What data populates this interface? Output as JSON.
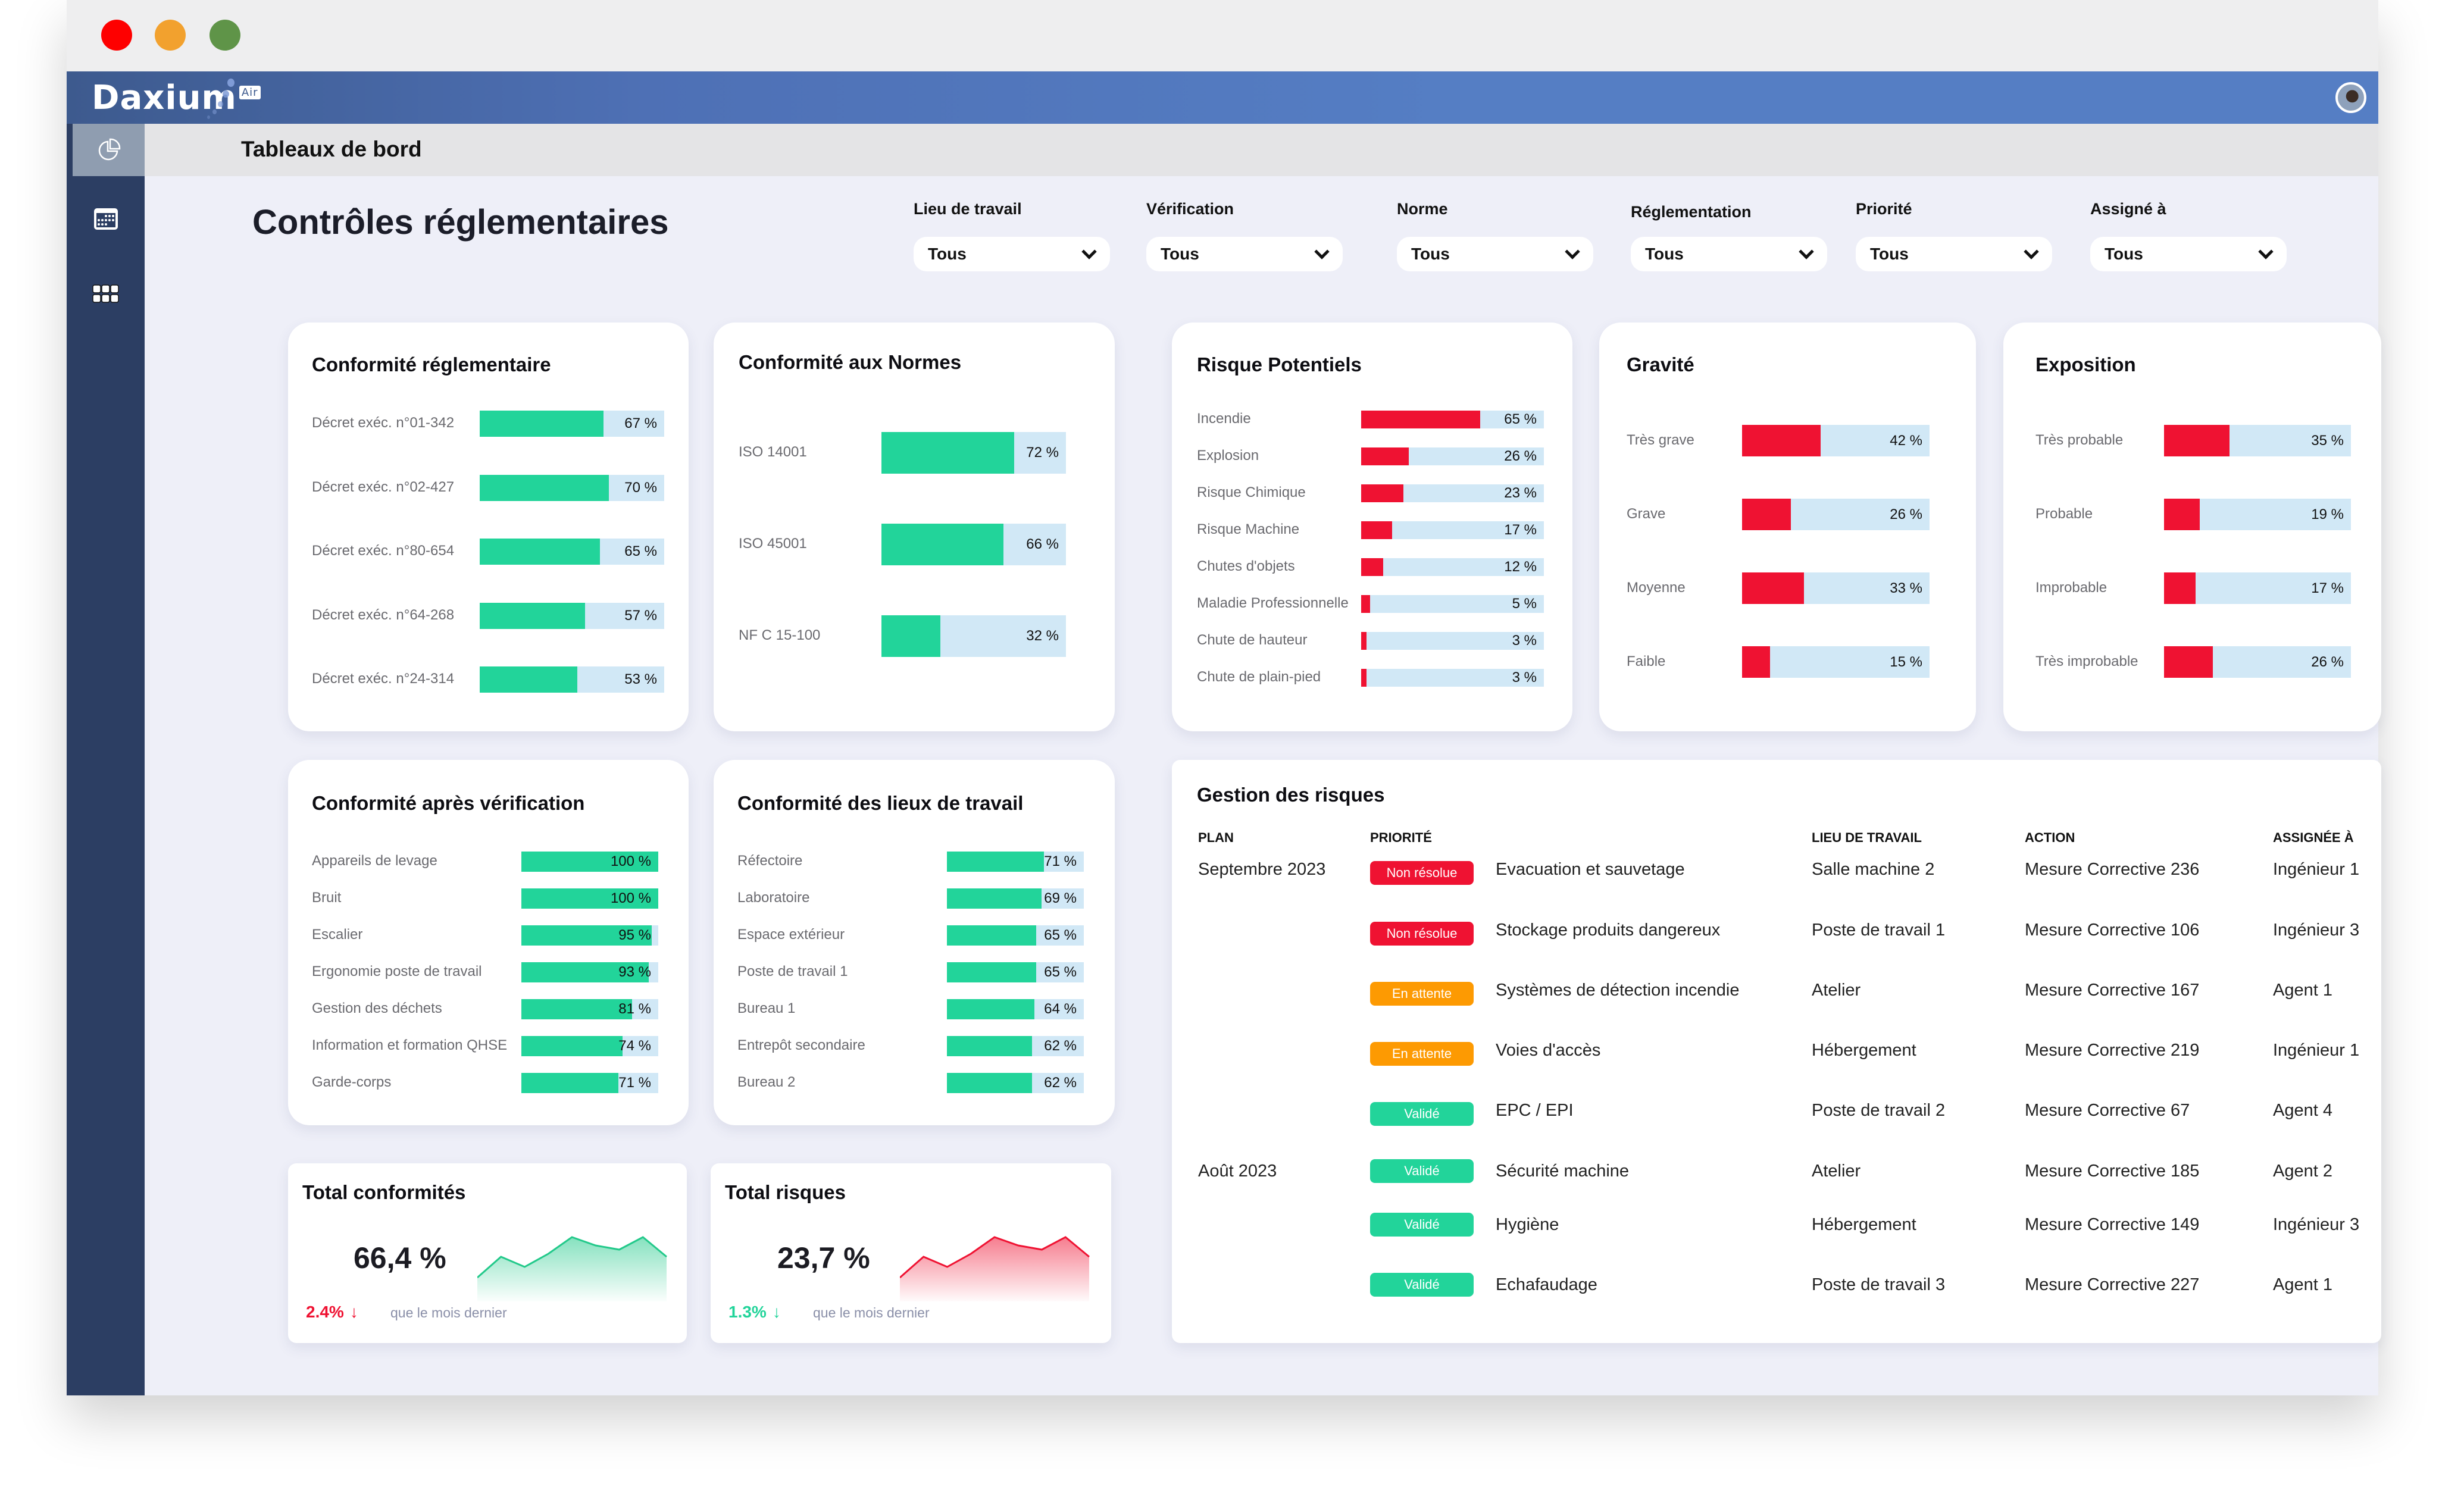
{
  "window": {
    "controls": [
      "close",
      "minimize",
      "maximize"
    ]
  },
  "header": {
    "logo": "Daxium",
    "logo_badge": "Air",
    "avatar_icon": "user-avatar"
  },
  "subheader": {
    "title": "Tableaux de bord"
  },
  "sidebar": {
    "items": [
      {
        "icon": "pie-chart-icon",
        "label": "Tableaux de bord",
        "active": true
      },
      {
        "icon": "calendar-icon",
        "label": "Calendrier"
      },
      {
        "icon": "apps-grid-icon",
        "label": "Applications"
      }
    ]
  },
  "page": {
    "title": "Contrôles réglementaires"
  },
  "filters": [
    {
      "label": "Lieu de travail",
      "value": "Tous"
    },
    {
      "label": "Vérification",
      "value": "Tous"
    },
    {
      "label": "Norme",
      "value": "Tous"
    },
    {
      "label": "Réglementation",
      "value": "Tous"
    },
    {
      "label": "Priorité",
      "value": "Tous"
    },
    {
      "label": "Assigné à",
      "value": "Tous"
    }
  ],
  "colors": {
    "green": "#22d49a",
    "red": "#ef1232",
    "track": "#d1e8f6",
    "orange": "#fd9a02"
  },
  "chart_data": [
    {
      "type": "bar",
      "title": "Conformité réglementaire",
      "orientation": "horizontal",
      "unit": "%",
      "xlim": [
        0,
        100
      ],
      "categories": [
        "Décret exéc. n°01-342",
        "Décret exéc. n°02-427",
        "Décret exéc. n°80-654",
        "Décret exéc. n°64-268",
        "Décret exéc. n°24-314"
      ],
      "values": [
        67,
        70,
        65,
        57,
        53
      ],
      "labels": [
        "67 %",
        "70 %",
        "65 %",
        "57 %",
        "53 %"
      ],
      "color": "#22d49a"
    },
    {
      "type": "bar",
      "title": "Conformité aux Normes",
      "orientation": "horizontal",
      "unit": "%",
      "xlim": [
        0,
        100
      ],
      "categories": [
        "ISO 14001",
        "ISO 45001",
        "NF C 15-100"
      ],
      "values": [
        72,
        66,
        32
      ],
      "labels": [
        "72 %",
        "66 %",
        "32 %"
      ],
      "color": "#22d49a"
    },
    {
      "type": "bar",
      "title": "Risque Potentiels",
      "orientation": "horizontal",
      "unit": "%",
      "xlim": [
        0,
        100
      ],
      "categories": [
        "Incendie",
        "Explosion",
        "Risque Chimique",
        "Risque Machine",
        "Chutes d'objets",
        "Maladie Professionnelle",
        "Chute de hauteur",
        "Chute de plain-pied"
      ],
      "values": [
        65,
        26,
        23,
        17,
        12,
        5,
        3,
        3
      ],
      "labels": [
        "65 %",
        "26 %",
        "23 %",
        "17 %",
        "12 %",
        "5 %",
        "3 %",
        "3 %"
      ],
      "color": "#ef1232"
    },
    {
      "type": "bar",
      "title": "Gravité",
      "orientation": "horizontal",
      "unit": "%",
      "xlim": [
        0,
        100
      ],
      "categories": [
        "Très grave",
        "Grave",
        "Moyenne",
        "Faible"
      ],
      "values": [
        42,
        26,
        33,
        15
      ],
      "labels": [
        "42 %",
        "26 %",
        "33 %",
        "15 %"
      ],
      "color": "#ef1232"
    },
    {
      "type": "bar",
      "title": "Exposition",
      "orientation": "horizontal",
      "unit": "%",
      "xlim": [
        0,
        100
      ],
      "categories": [
        "Très probable",
        "Probable",
        "Improbable",
        "Très improbable"
      ],
      "values": [
        35,
        19,
        17,
        26
      ],
      "labels": [
        "35 %",
        "19 %",
        "17 %",
        "26 %"
      ],
      "color": "#ef1232"
    },
    {
      "type": "bar",
      "title": "Conformité après vérification",
      "orientation": "horizontal",
      "unit": "%",
      "xlim": [
        0,
        100
      ],
      "categories": [
        "Appareils de levage",
        "Bruit",
        "Escalier",
        "Ergonomie poste de travail",
        "Gestion des déchets",
        "Information et formation QHSE",
        "Garde-corps"
      ],
      "values": [
        100,
        100,
        95,
        93,
        81,
        74,
        71
      ],
      "labels": [
        "100 %",
        "100 %",
        "95 %",
        "93 %",
        "81 %",
        "74 %",
        "71 %"
      ],
      "color": "#22d49a"
    },
    {
      "type": "bar",
      "title": "Conformité des lieux de travail",
      "orientation": "horizontal",
      "unit": "%",
      "xlim": [
        0,
        100
      ],
      "categories": [
        "Réfectoire",
        "Laboratoire",
        "Espace extérieur",
        "Poste de travail 1",
        "Bureau 1",
        "Entrepôt secondaire",
        "Bureau 2"
      ],
      "values": [
        71,
        69,
        65,
        65,
        64,
        62,
        62
      ],
      "labels": [
        "71 %",
        "69 %",
        "65 %",
        "65 %",
        "64 %",
        "62 %",
        "62 %"
      ],
      "color": "#22d49a"
    },
    {
      "type": "area",
      "title": "Total conformités",
      "values": [
        20,
        55,
        38,
        60,
        88,
        74,
        67,
        88,
        55
      ],
      "color": "#22c98a"
    },
    {
      "type": "area",
      "title": "Total risques",
      "values": [
        20,
        55,
        38,
        60,
        88,
        74,
        67,
        88,
        55
      ],
      "color": "#ef1232"
    }
  ],
  "totals": [
    {
      "title": "Total conformités",
      "value": "66,4 %",
      "delta": "2.4%",
      "delta_arrow": "↓",
      "delta_color": "#ef1232",
      "note": "que le mois dernier"
    },
    {
      "title": "Total risques",
      "value": "23,7 %",
      "delta": "1.3%",
      "delta_arrow": "↓",
      "delta_color": "#22d49a",
      "note": "que le mois dernier"
    }
  ],
  "risk_table": {
    "title": "Gestion des risques",
    "columns": {
      "plan": "PLAN",
      "priority": "PRIORITÉ",
      "workplace": "LIEU DE TRAVAIL",
      "action": "ACTION",
      "assignee": "ASSIGNÉE À"
    },
    "rows": [
      {
        "plan": "Septembre 2023",
        "status": "Non résolue",
        "status_color": "#ef1232",
        "item": "Evacuation et sauvetage",
        "workplace": "Salle machine 2",
        "action": "Mesure Corrective  236",
        "assignee": "Ingénieur 1"
      },
      {
        "plan": "",
        "status": "Non résolue",
        "status_color": "#ef1232",
        "item": "Stockage produits dangereux",
        "workplace": "Poste de travail 1",
        "action": "Mesure Corrective  106",
        "assignee": "Ingénieur 3"
      },
      {
        "plan": "",
        "status": "En attente",
        "status_color": "#fd9a02",
        "item": "Systèmes de détection incendie",
        "workplace": "Atelier",
        "action": "Mesure Corrective 167",
        "assignee": "Agent 1"
      },
      {
        "plan": "",
        "status": "En attente",
        "status_color": "#fd9a02",
        "item": "Voies d'accès",
        "workplace": "Hébergement",
        "action": "Mesure Corrective 219",
        "assignee": "Ingénieur 1"
      },
      {
        "plan": "",
        "status": "Validé",
        "status_color": "#22d49a",
        "item": "EPC / EPI",
        "workplace": "Poste de travail 2",
        "action": "Mesure Corrective 67",
        "assignee": "Agent 4"
      },
      {
        "plan": "Août 2023",
        "status": "Validé",
        "status_color": "#22d49a",
        "item": "Sécurité machine",
        "workplace": "Atelier",
        "action": "Mesure Corrective 185",
        "assignee": "Agent 2"
      },
      {
        "plan": "",
        "status": "Validé",
        "status_color": "#22d49a",
        "item": "Hygiène",
        "workplace": "Hébergement",
        "action": "Mesure Corrective 149",
        "assignee": "Ingénieur 3"
      },
      {
        "plan": "",
        "status": "Validé",
        "status_color": "#22d49a",
        "item": "Echafaudage",
        "workplace": "Poste de travail 3",
        "action": "Mesure Corrective 227",
        "assignee": "Agent 1"
      }
    ]
  }
}
